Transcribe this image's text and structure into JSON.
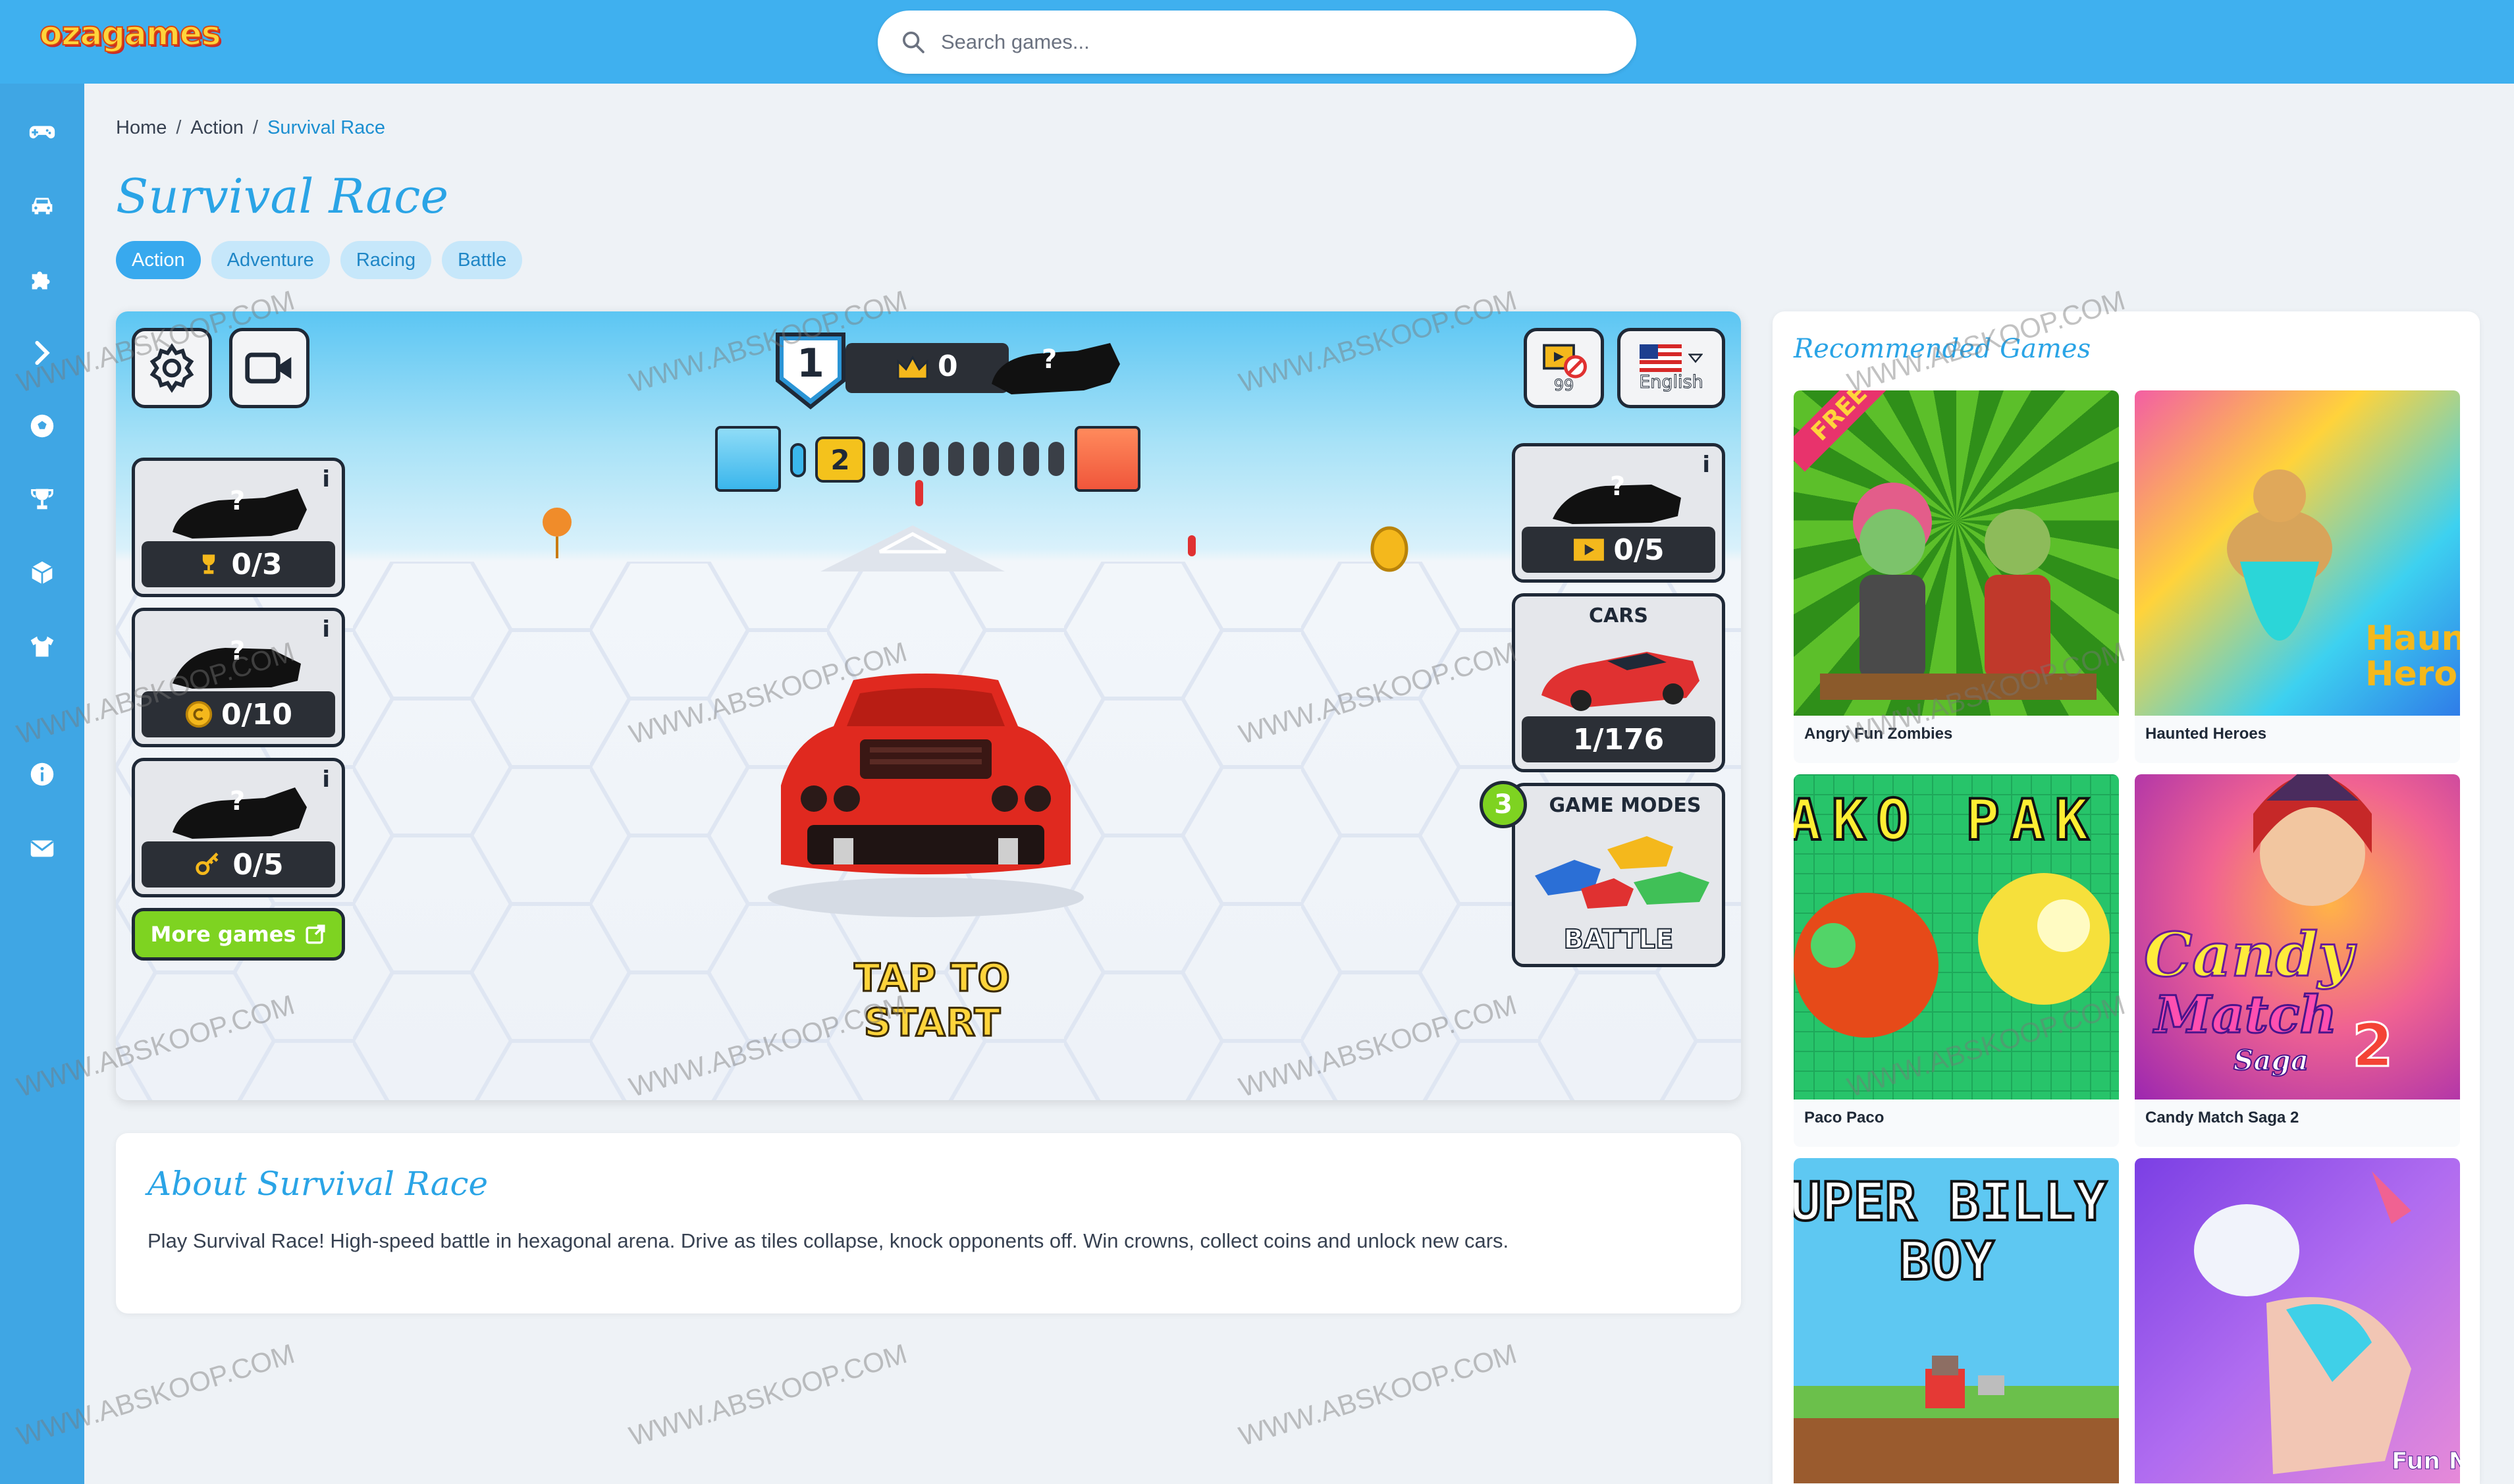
{
  "header": {
    "logo": "ozagames",
    "search_placeholder": "Search games..."
  },
  "sidebar": {
    "items": [
      {
        "icon": "gamepad-icon",
        "label": "Games"
      },
      {
        "icon": "car-icon",
        "label": "Car"
      },
      {
        "icon": "puzzle-icon",
        "label": "Puzzle"
      },
      {
        "icon": "arrow-icon",
        "label": "Action"
      },
      {
        "icon": "soccer-ball-icon",
        "label": "Sports"
      },
      {
        "icon": "trophy-icon",
        "label": "Top"
      },
      {
        "icon": "cube-icon",
        "label": "3D"
      },
      {
        "icon": "shirt-icon",
        "label": "Dress up"
      },
      {
        "icon": "info-icon",
        "label": "About"
      },
      {
        "icon": "mail-icon",
        "label": "Contact"
      }
    ]
  },
  "breadcrumb": {
    "home": "Home",
    "category": "Action",
    "current": "Survival Race"
  },
  "page_title": "Survival Race",
  "tags": [
    "Action",
    "Adventure",
    "Racing",
    "Battle"
  ],
  "game": {
    "rank": "1",
    "crowns": "0",
    "level_current": "2",
    "language": "English",
    "ads_count": "99",
    "unknown_mark": "?",
    "info_mark": "i",
    "challenges": [
      {
        "counter": "0/3",
        "icon": "trophy-icon"
      },
      {
        "counter": "0/10",
        "icon": "coin-icon"
      },
      {
        "counter": "0/5",
        "icon": "key-icon"
      }
    ],
    "video_challenge": "0/5",
    "cars_label": "CARS",
    "cars_counter": "1/176",
    "modes_count": "3",
    "modes_label": "GAME MODES",
    "battle_label": "BATTLE",
    "more_games": "More games",
    "tap_to_start": "TAP TO START"
  },
  "about": {
    "title": "About Survival Race",
    "text": "Play Survival Race! High-speed battle in hexagonal arena. Drive as tiles collapse, knock opponents off. Win crowns, collect coins and unlock new cars."
  },
  "recommended": {
    "title": "Recommended Games",
    "games": [
      {
        "name": "Angry Fun Zombies"
      },
      {
        "name": "Haunted Heroes"
      },
      {
        "name": "Paco Paco"
      },
      {
        "name": "Candy Match Saga 2"
      },
      {
        "name": ""
      },
      {
        "name": ""
      }
    ],
    "thumb_texts": {
      "haunted": "Haun Hero",
      "paco": "AKO PAK",
      "candy_1": "Candy",
      "candy_2": "Match",
      "candy_3": "Saga",
      "candy_4": "2",
      "billy_1": "UPER BILLY",
      "billy_2": "BOY",
      "nails": "Fun Na",
      "free_ribbon": "FREE"
    }
  },
  "watermark": "WWW.ABSKOOP.COM",
  "colors": {
    "header": "#3fb0ef",
    "sidebar": "#3fa6e4",
    "accent": "#2aa4e6",
    "tag_bg": "#c6e7fa",
    "more_games_green": "#7ed321"
  }
}
